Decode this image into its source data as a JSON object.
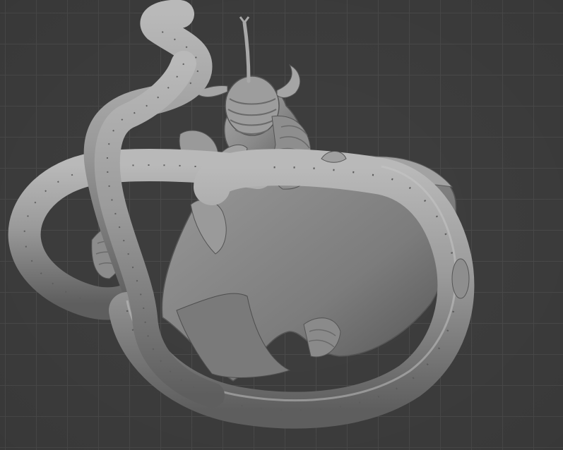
{
  "viewport": {
    "background_color": "#3d3d3d",
    "grid_color": "#4a4a4a",
    "object_color": "#8d8d8d",
    "object_highlight": "#b8b8b8",
    "object_shadow": "#5a5a5a",
    "object": "sculpted-creature-model"
  }
}
